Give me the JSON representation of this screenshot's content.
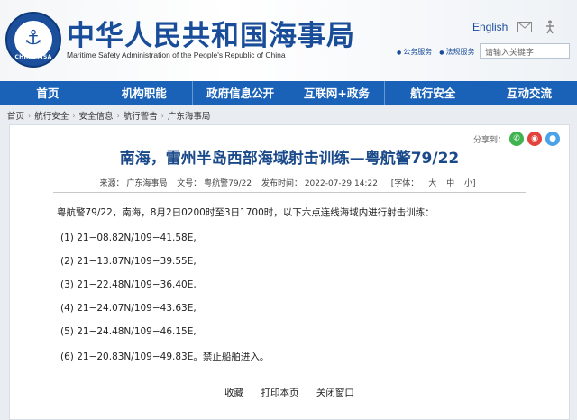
{
  "header": {
    "logo_text": "CHINA MSA",
    "title_cn": "中华人民共和国海事局",
    "title_en": "Maritime Safety Administration of the People's Republic of China",
    "language_link": "English",
    "mini_links": [
      "公务服务",
      "法规服务"
    ],
    "search_placeholder": "请输入关键字"
  },
  "nav": {
    "items": [
      "首页",
      "机构职能",
      "政府信息公开",
      "互联网+政务",
      "航行安全",
      "互动交流"
    ]
  },
  "breadcrumb": [
    "首页",
    "航行安全",
    "安全信息",
    "航行警告",
    "广东海事局"
  ],
  "share": {
    "label": "分享到："
  },
  "article": {
    "title": "南海，雷州半岛西部海域射击训练—粤航警79/22",
    "source": "来源：  广东海事局",
    "doc_no": "文号：  粤航警79/22",
    "published": "发布时间：  2022-07-29 14:22",
    "font_label": "[字体：",
    "font_large": "大",
    "font_medium": "中",
    "font_small": "小]",
    "intro": "粤航警79/22，南海，8月2日0200时至3日1700时，以下六点连线海域内进行射击训练：",
    "points": [
      "(1)  21−08.82N/109−41.58E,",
      "(2)  21−13.87N/109−39.55E,",
      "(3)  21−22.48N/109−36.40E,",
      "(4)  21−24.07N/109−43.63E,",
      "(5)  21−24.48N/109−46.15E,",
      "(6)  21−20.83N/109−49.83E。禁止船舶进入。"
    ]
  },
  "actions": {
    "favorite": "收藏",
    "print": "打印本页",
    "close": "关闭窗口"
  },
  "colors": {
    "brand_blue": "#1a62b8",
    "title_blue": "#1a4d99"
  }
}
